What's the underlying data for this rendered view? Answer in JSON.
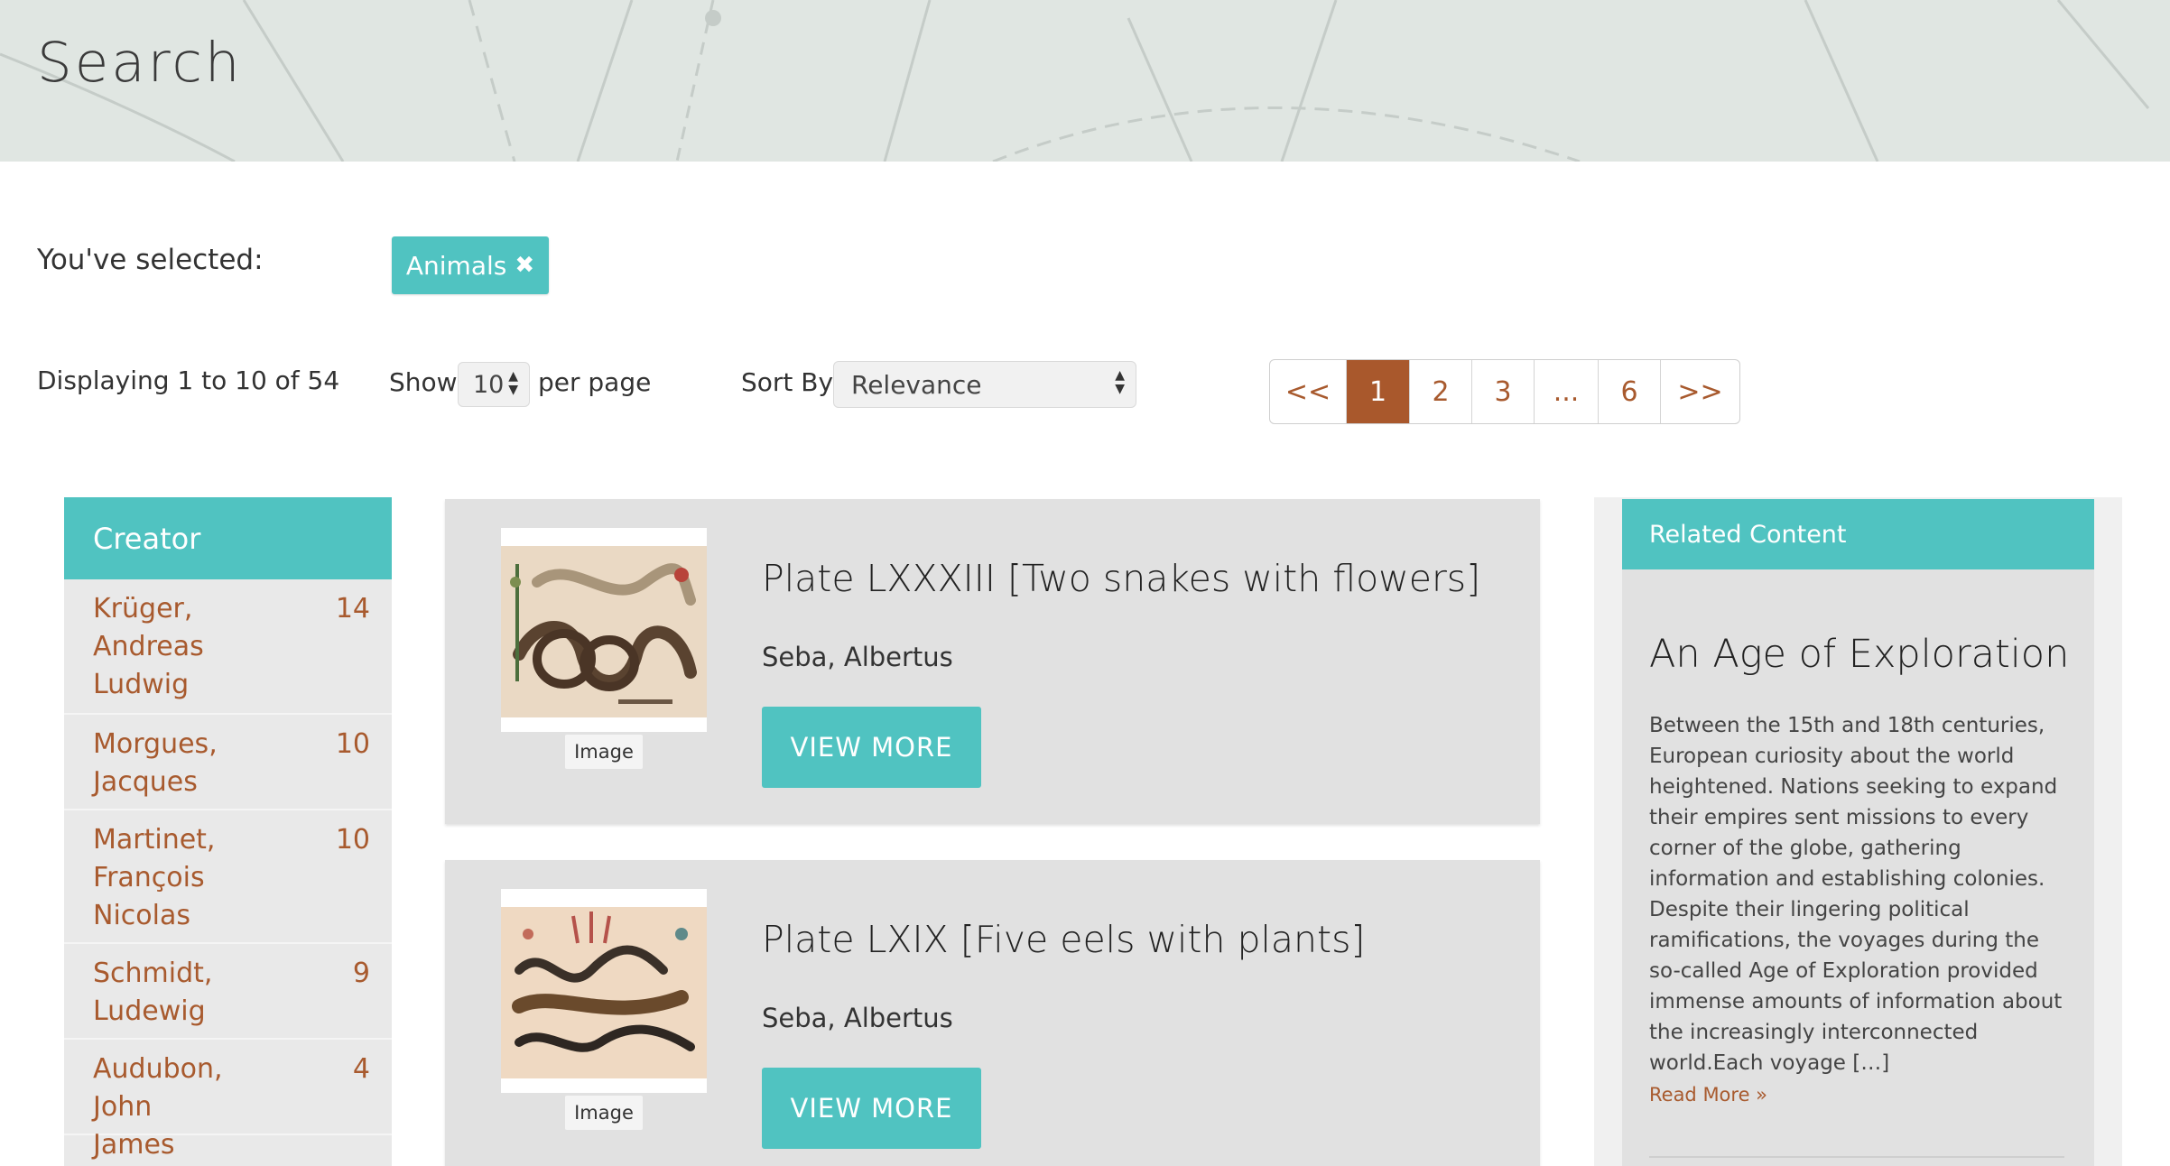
{
  "page_title": "Search",
  "selection": {
    "label": "You've selected:",
    "chips": [
      {
        "label": "Animals",
        "remove_icon": "✖"
      }
    ]
  },
  "results_info": "Displaying 1 to 10 of 54",
  "per_page": {
    "show_label": "Show",
    "value": "10",
    "suffix": "per page"
  },
  "sort": {
    "label": "Sort By:",
    "value": "Relevance"
  },
  "pagination": {
    "prev": "<<",
    "pages": [
      "1",
      "2",
      "3",
      "...",
      "6"
    ],
    "current": "1",
    "next": ">>"
  },
  "facet": {
    "title": "Creator",
    "items": [
      {
        "name": "Krüger, Andreas Ludwig",
        "count": "14"
      },
      {
        "name": "Morgues, Jacques",
        "count": "10"
      },
      {
        "name": "Martinet, François Nicolas",
        "count": "10"
      },
      {
        "name": "Schmidt, Ludewig",
        "count": "9"
      },
      {
        "name": "Audubon, John James",
        "count": "4"
      }
    ]
  },
  "results": [
    {
      "title": "Plate LXXXIII [Two snakes with flowers]",
      "creator": "Seba, Albertus",
      "type_badge": "Image",
      "button": "VIEW MORE"
    },
    {
      "title": "Plate LXIX [Five eels with plants]",
      "creator": "Seba, Albertus",
      "type_badge": "Image",
      "button": "VIEW MORE"
    }
  ],
  "related": {
    "header": "Related Content",
    "title": "An Age of Exploration",
    "body": "Between the 15th and 18th centuries, European curiosity about the world heightened. Nations seeking to expand their empires sent missions to every corner of the globe, gathering information and establishing colonies. Despite their lingering political ramifications, the voyages during the so-called Age of Exploration provided immense amounts of information about the increasingly interconnected world.Each voyage […]",
    "read_more": "Read More »"
  },
  "colors": {
    "accent": "#50c3c1",
    "link": "#a85a2e",
    "active_page": "#a9582c",
    "card_bg": "#e1e1e1"
  },
  "icons": {
    "chip_remove": "close-icon",
    "select_arrows": "sort-arrows-icon",
    "read_more": "double-chevron-right-icon"
  }
}
